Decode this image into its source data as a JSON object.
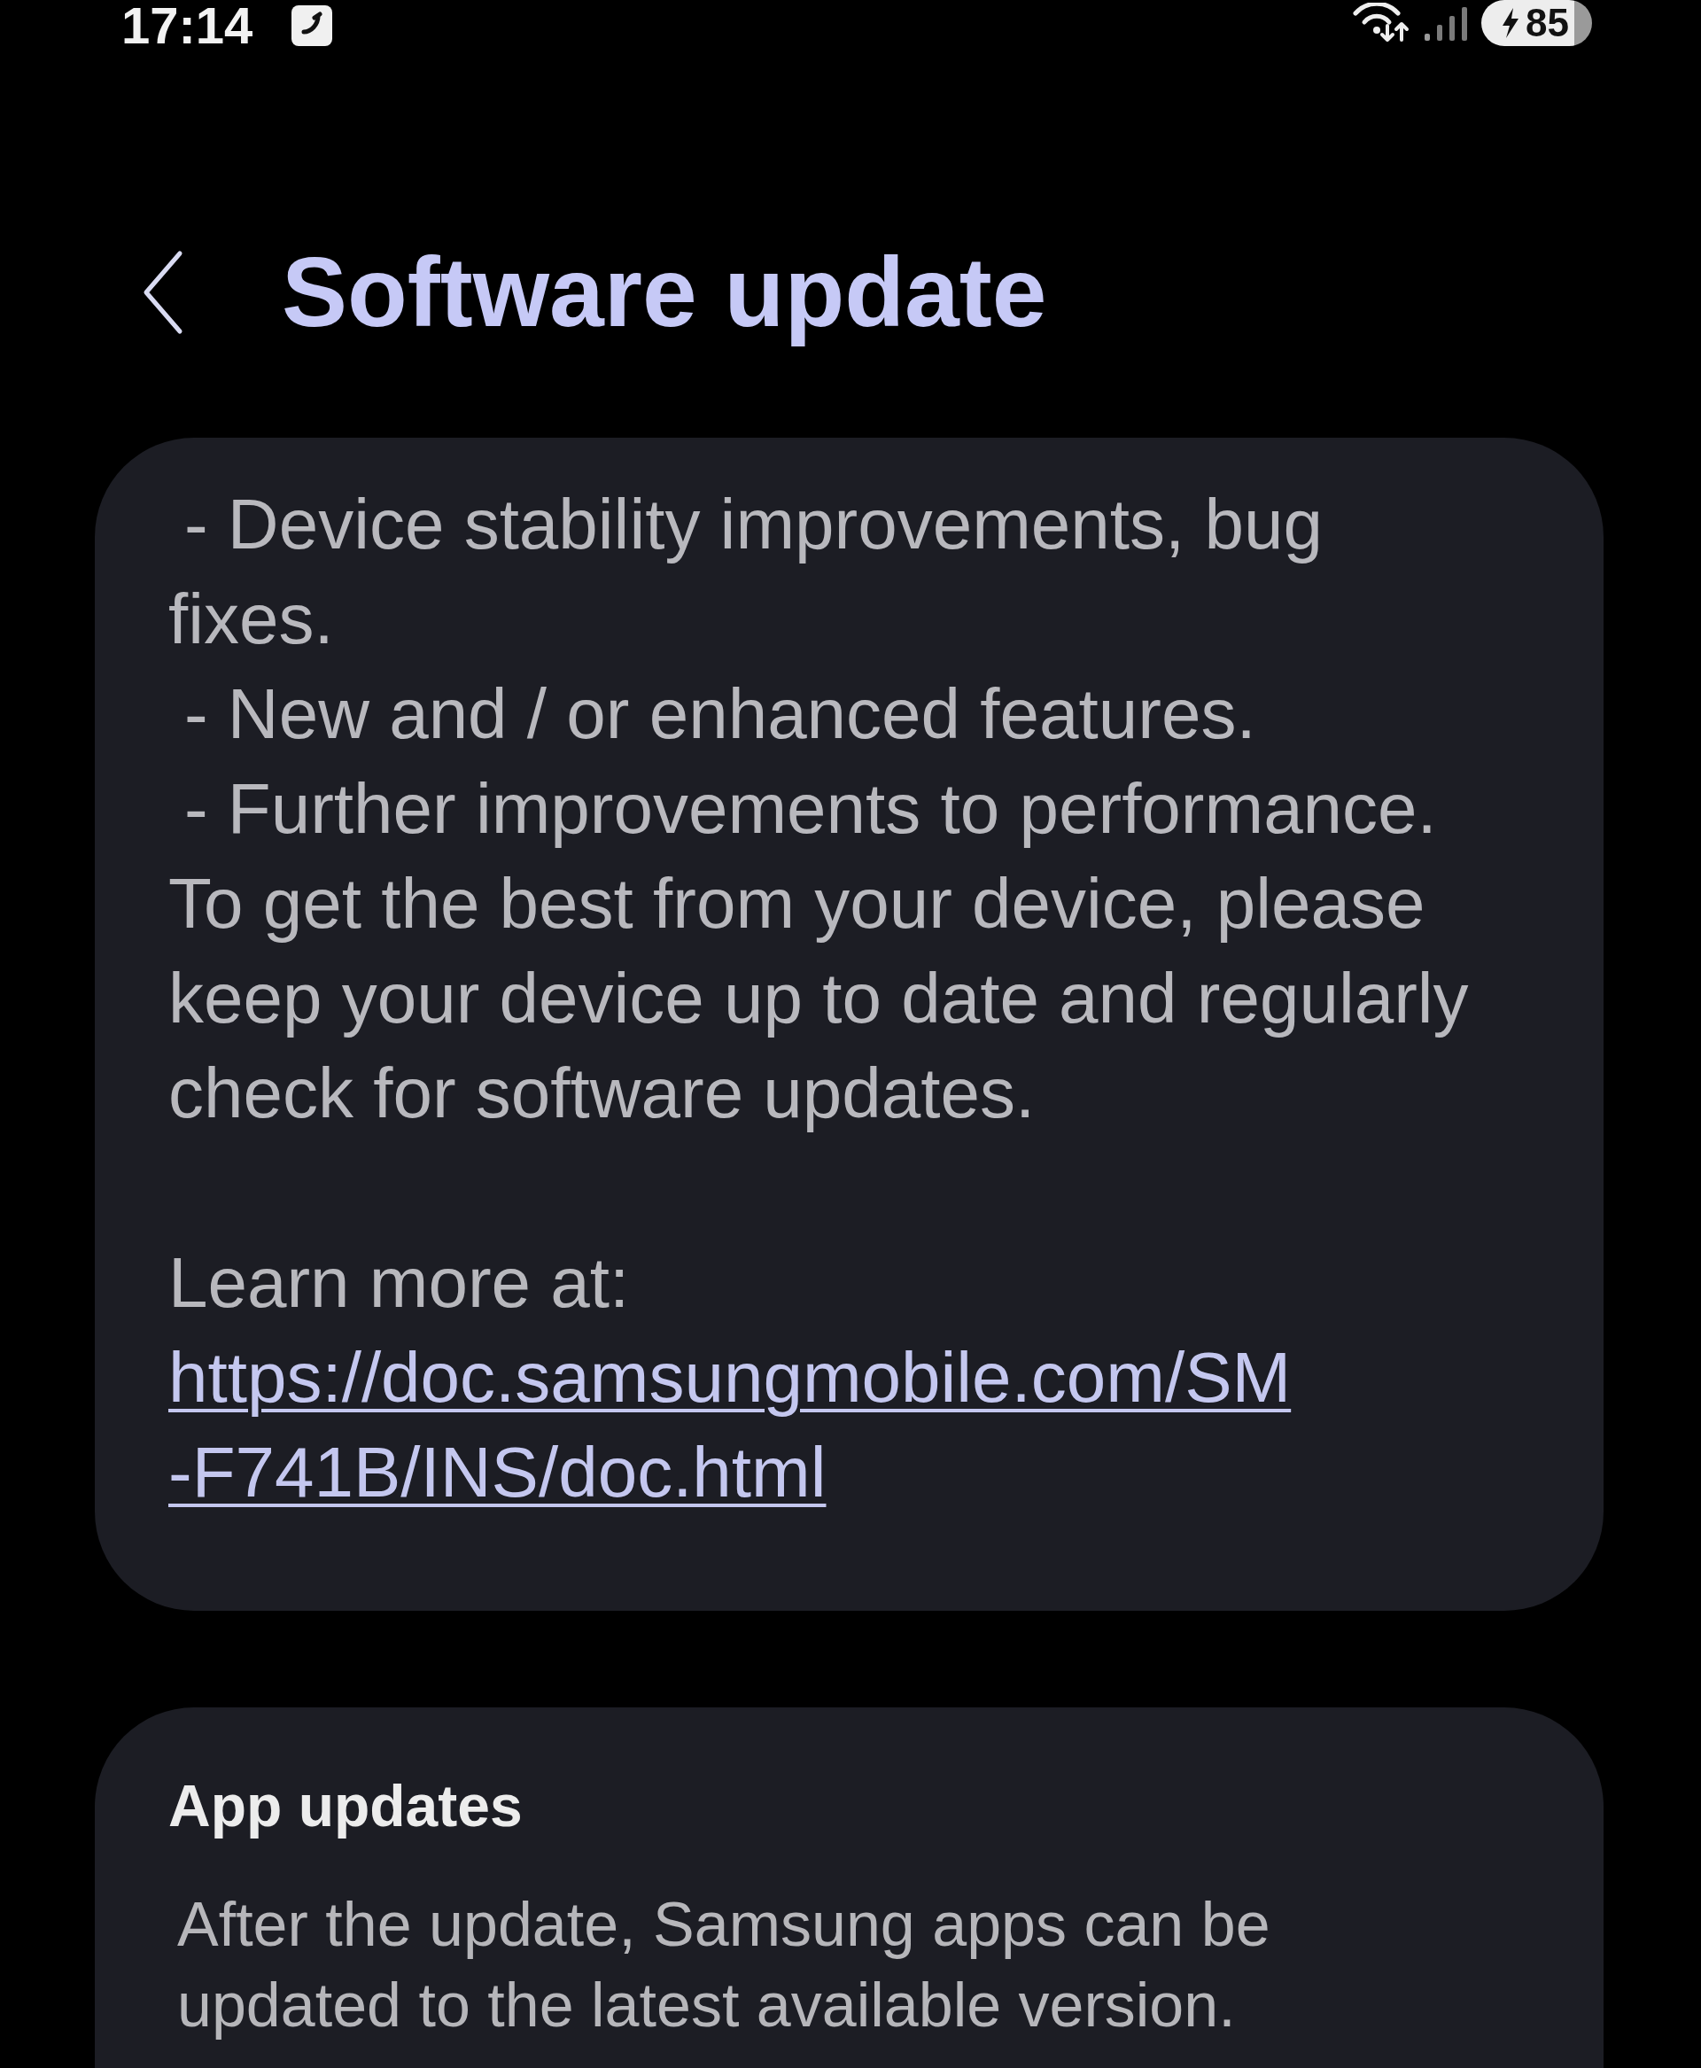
{
  "status_bar": {
    "time": "17:14",
    "battery": "85"
  },
  "header": {
    "title": "Software update"
  },
  "release_notes": {
    "items": [
      "- Device stability improvements, bug fixes.",
      "- New and / or enhanced features.",
      "- Further improvements to performance."
    ],
    "paragraph": "To get the best from your device, please keep your device up to date and regularly check for software updates.",
    "learn_more": "Learn more at:",
    "link": "https://doc.samsungmobile.com/SM-F741B/INS/doc.html"
  },
  "app_updates": {
    "title": "App updates",
    "description": "After the update, Samsung apps can be updated to the latest available version."
  }
}
